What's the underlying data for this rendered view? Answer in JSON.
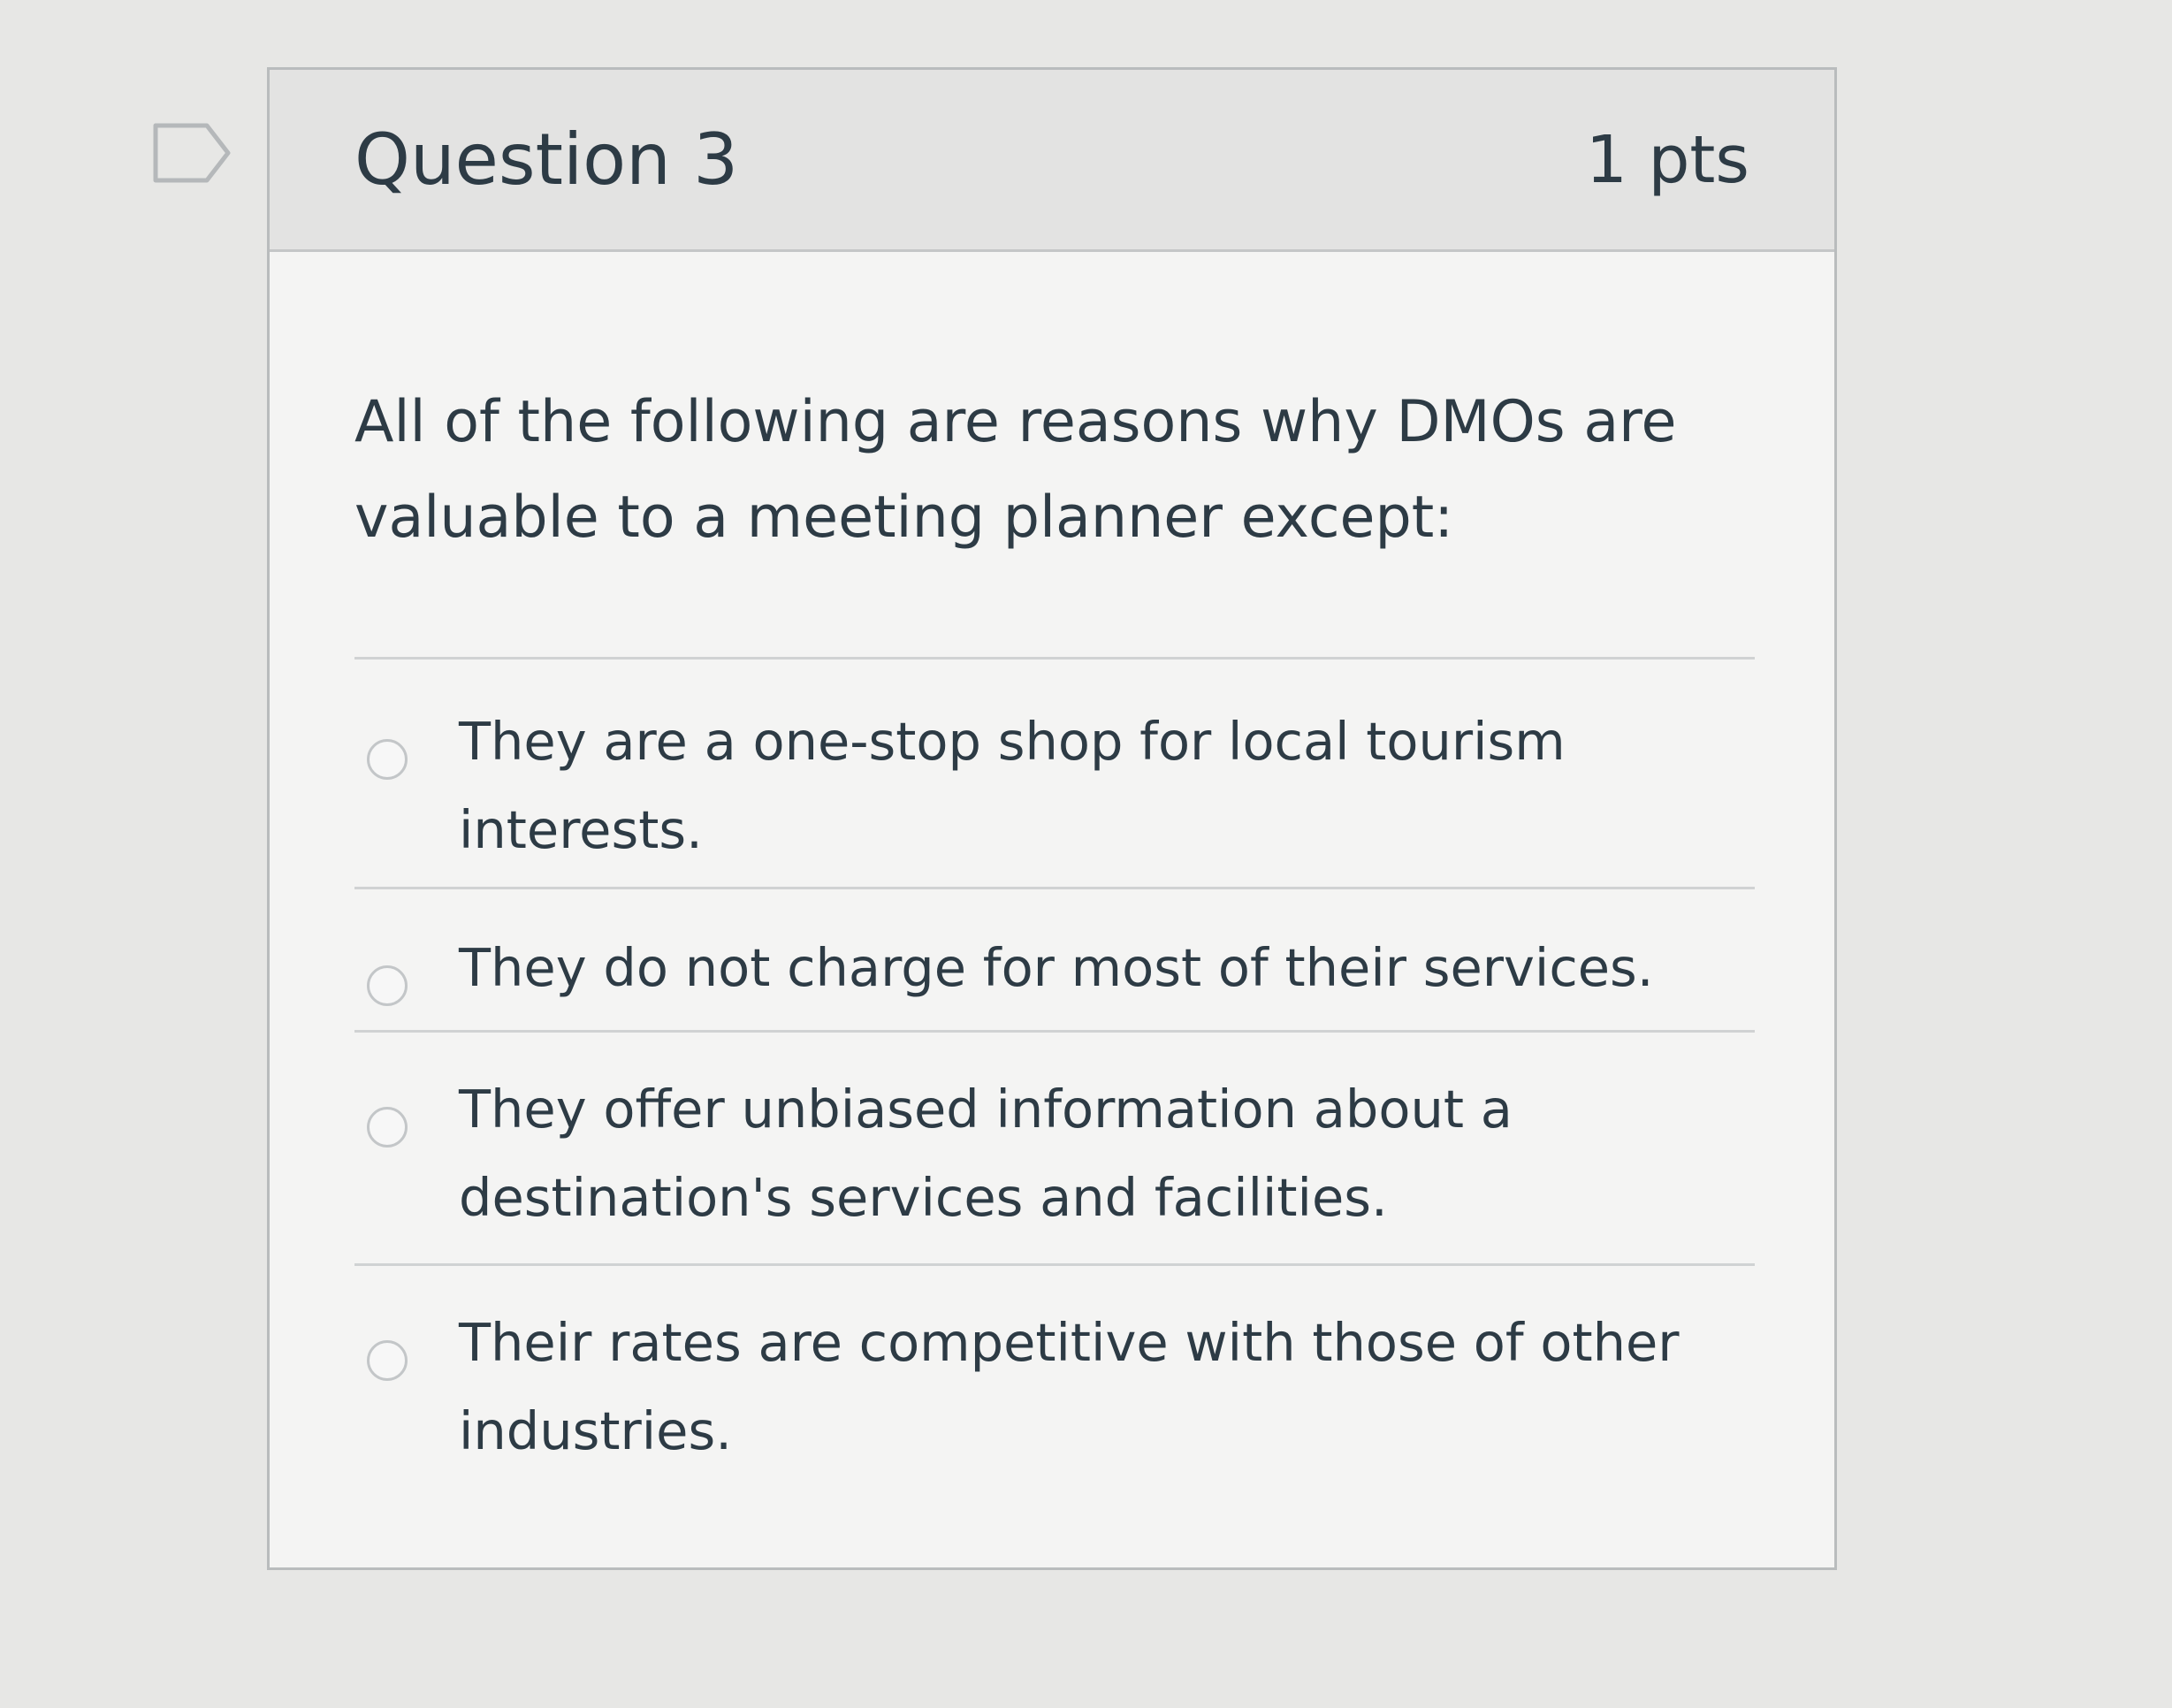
{
  "question": {
    "title": "Question 3",
    "points": "1 pts",
    "text": "All of the following are reasons why DMOs are valuable to a meeting planner except:",
    "answers": [
      {
        "label": "They are a one-stop shop for local tourism interests."
      },
      {
        "label": "They do not charge for most of their services."
      },
      {
        "label": "They offer unbiased information about a destination's services and facilities."
      },
      {
        "label": "Their rates are competitive with those of other industries."
      }
    ]
  },
  "colors": {
    "page_bg": "#e7e7e5",
    "card_bg": "#f4f4f3",
    "header_bg": "#e3e3e2",
    "text": "#2d3b45",
    "border": "#b9bcbd"
  },
  "icons": {
    "flag": "flag-outline-icon"
  }
}
